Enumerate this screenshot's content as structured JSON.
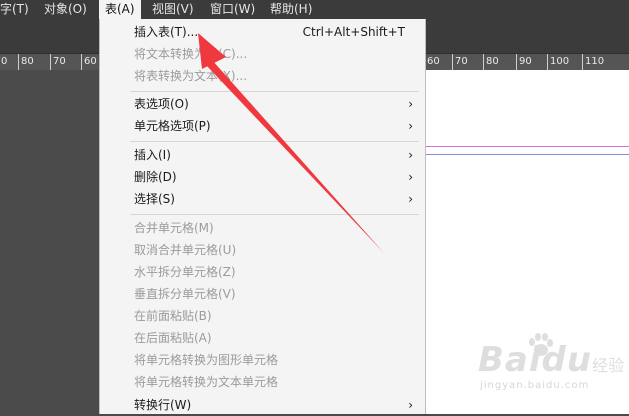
{
  "menubar": {
    "items": [
      "字(T)",
      "对象(O)",
      "表(A)",
      "视图(V)",
      "窗口(W)",
      "帮助(H)"
    ],
    "active_index": 2
  },
  "ruler_left": [
    "0",
    "80",
    "70",
    "60"
  ],
  "ruler_right": [
    "60",
    "70",
    "80",
    "90",
    "100",
    "110"
  ],
  "menu": {
    "insert_table": {
      "label": "插入表(T)...",
      "shortcut": "Ctrl+Alt+Shift+T",
      "enabled": true
    },
    "text_to_table": {
      "label": "将文本转换为表(C)...",
      "enabled": false
    },
    "table_to_text": {
      "label": "将表转换为文本(X)...",
      "enabled": false
    },
    "table_options": {
      "label": "表选项(O)",
      "enabled": true
    },
    "cell_options": {
      "label": "单元格选项(P)",
      "enabled": true
    },
    "insert": {
      "label": "插入(I)",
      "enabled": true
    },
    "delete": {
      "label": "删除(D)",
      "enabled": true
    },
    "select": {
      "label": "选择(S)",
      "enabled": true
    },
    "merge_cells": {
      "label": "合并单元格(M)",
      "enabled": false
    },
    "unmerge_cells": {
      "label": "取消合并单元格(U)",
      "enabled": false
    },
    "split_horizontal": {
      "label": "水平拆分单元格(Z)",
      "enabled": false
    },
    "split_vertical": {
      "label": "垂直拆分单元格(V)",
      "enabled": false
    },
    "paste_before": {
      "label": "在前面粘贴(B)",
      "enabled": false
    },
    "paste_after": {
      "label": "在后面粘贴(A)",
      "enabled": false
    },
    "to_graphic_cell": {
      "label": "将单元格转换为图形单元格",
      "enabled": false
    },
    "to_text_cell": {
      "label": "将单元格转换为文本单元格",
      "enabled": false
    },
    "convert_rows": {
      "label": "转换行(W)",
      "enabled": true
    }
  },
  "watermark": {
    "brand": "Baidu",
    "sub": "经验",
    "url": "jingyan.baidu.com"
  },
  "colors": {
    "arrow": "#f0393f",
    "menu_bg": "#f4f4f4",
    "chrome": "#3b3b3b"
  }
}
